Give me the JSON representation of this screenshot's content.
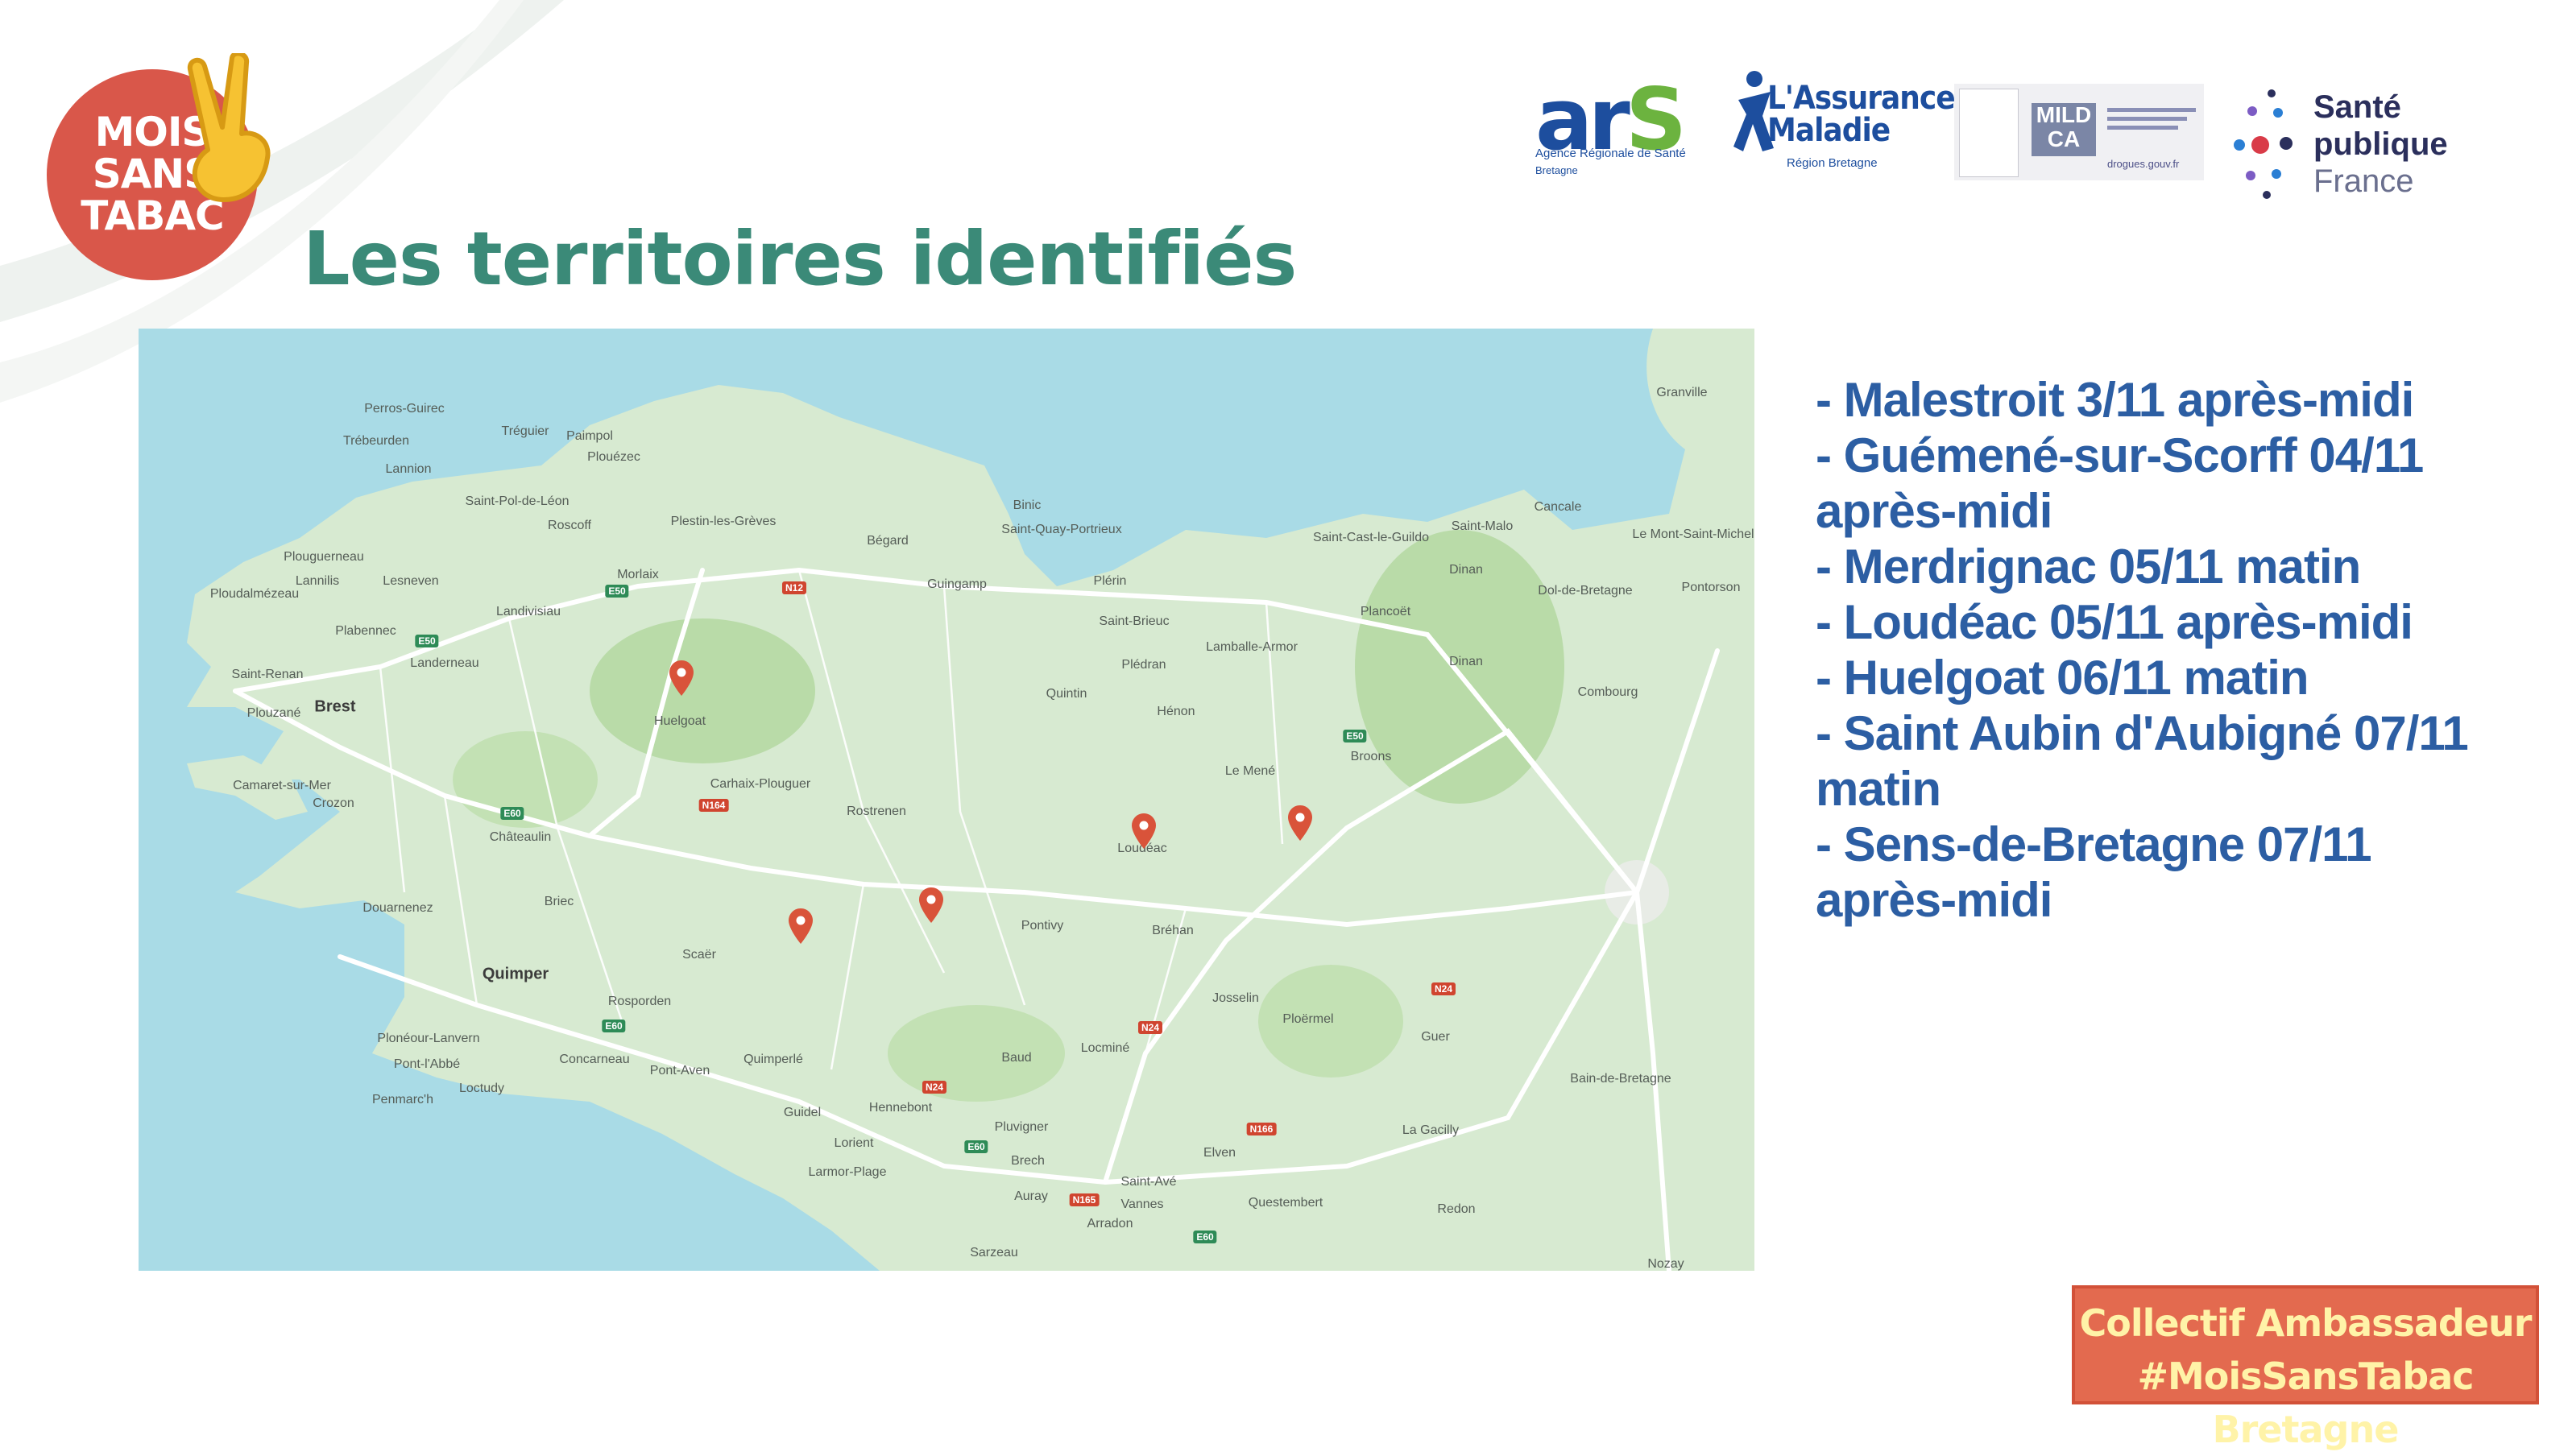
{
  "slide": {
    "title": "Les territoires identifiés"
  },
  "logo": {
    "line1": "MOIS",
    "line2": "SANS",
    "line3": "TABAC"
  },
  "partners": {
    "ars": {
      "main": "ar",
      "accent": "S",
      "subtitle": "Agence Régionale de Santé",
      "region": "Bretagne"
    },
    "assurance_maladie": {
      "line1": "L'Assurance",
      "line2": "Maladie",
      "region": "Région Bretagne"
    },
    "mildeca": {
      "acronym": "MILD CA",
      "url": "drogues.gouv.fr"
    },
    "spf": {
      "line1": "Santé",
      "line2": "publique",
      "line3": "France"
    }
  },
  "map": {
    "places": [
      {
        "name": "Perros-Guirec"
      },
      {
        "name": "Trébeurden"
      },
      {
        "name": "Tréguier"
      },
      {
        "name": "Paimpol"
      },
      {
        "name": "Plouézec"
      },
      {
        "name": "Lannion"
      },
      {
        "name": "Roscoff"
      },
      {
        "name": "Saint-Pol-de-Léon"
      },
      {
        "name": "Plestin-les-Grèves"
      },
      {
        "name": "Binic"
      },
      {
        "name": "Saint-Quay-Portrieux"
      },
      {
        "name": "Bégard"
      },
      {
        "name": "Saint-Cast-le-Guildo"
      },
      {
        "name": "Saint-Malo"
      },
      {
        "name": "Cancale"
      },
      {
        "name": "Granville"
      },
      {
        "name": "Le Mont-Saint-Michel"
      },
      {
        "name": "Plouguerneau"
      },
      {
        "name": "Lannilis"
      },
      {
        "name": "Lesneven"
      },
      {
        "name": "Morlaix"
      },
      {
        "name": "Guingamp"
      },
      {
        "name": "Plérin"
      },
      {
        "name": "Plancoët"
      },
      {
        "name": "Dinan"
      },
      {
        "name": "Dol-de-Bretagne"
      },
      {
        "name": "Pontorson"
      },
      {
        "name": "Ploudalmézeau"
      },
      {
        "name": "Landivisiau"
      },
      {
        "name": "Plabennec"
      },
      {
        "name": "Saint-Brieuc"
      },
      {
        "name": "Lamballe-Armor"
      },
      {
        "name": "Landerneau"
      },
      {
        "name": "Saint-Renan"
      },
      {
        "name": "Plédran"
      },
      {
        "name": "Dinan"
      },
      {
        "name": "Brest"
      },
      {
        "name": "Plouzané"
      },
      {
        "name": "Quintin"
      },
      {
        "name": "Hénon"
      },
      {
        "name": "Combourg"
      },
      {
        "name": "Huelgoat"
      },
      {
        "name": "Le Mené"
      },
      {
        "name": "Broons"
      },
      {
        "name": "Camaret-sur-Mer"
      },
      {
        "name": "Crozon"
      },
      {
        "name": "Carhaix-Plouguer"
      },
      {
        "name": "Rostrenen"
      },
      {
        "name": "Loudéac"
      },
      {
        "name": "Châteaulin"
      },
      {
        "name": "Douarnenez"
      },
      {
        "name": "Briec"
      },
      {
        "name": "Pontivy"
      },
      {
        "name": "Bréhan"
      },
      {
        "name": "Scaër"
      },
      {
        "name": "Quimper"
      },
      {
        "name": "Josselin"
      },
      {
        "name": "Ploërmel"
      },
      {
        "name": "Rosporden"
      },
      {
        "name": "Locminé"
      },
      {
        "name": "Guer"
      },
      {
        "name": "Plonéour-Lanvern"
      },
      {
        "name": "Baud"
      },
      {
        "name": "Pont-l'Abbé"
      },
      {
        "name": "Concarneau"
      },
      {
        "name": "Pont-Aven"
      },
      {
        "name": "Quimperlé"
      },
      {
        "name": "Bain-de-Bretagne"
      },
      {
        "name": "Loctudy"
      },
      {
        "name": "Penmarc'h"
      },
      {
        "name": "Hennebont"
      },
      {
        "name": "Guidel"
      },
      {
        "name": "Pluvigner"
      },
      {
        "name": "Lorient"
      },
      {
        "name": "La Gacilly"
      },
      {
        "name": "Larmor-Plage"
      },
      {
        "name": "Brech"
      },
      {
        "name": "Elven"
      },
      {
        "name": "Auray"
      },
      {
        "name": "Saint-Avé"
      },
      {
        "name": "Vannes"
      },
      {
        "name": "Questembert"
      },
      {
        "name": "Redon"
      },
      {
        "name": "Arradon"
      },
      {
        "name": "Sarzeau"
      },
      {
        "name": "Nozay"
      }
    ],
    "roads": [
      {
        "label": "N12",
        "color": "red"
      },
      {
        "label": "E50",
        "color": "green"
      },
      {
        "label": "E50",
        "color": "green"
      },
      {
        "label": "E50",
        "color": "green"
      },
      {
        "label": "N164",
        "color": "red"
      },
      {
        "label": "E60",
        "color": "green"
      },
      {
        "label": "E60",
        "color": "green"
      },
      {
        "label": "N24",
        "color": "red"
      },
      {
        "label": "N24",
        "color": "red"
      },
      {
        "label": "N24",
        "color": "red"
      },
      {
        "label": "E60",
        "color": "green"
      },
      {
        "label": "N165",
        "color": "red"
      },
      {
        "label": "N166",
        "color": "red"
      },
      {
        "label": "E60",
        "color": "green"
      }
    ],
    "markers": [
      {
        "name": "Huelgoat"
      },
      {
        "name": "Guémené-sur-Scorff"
      },
      {
        "name": "Rostrenen area"
      },
      {
        "name": "Loudéac"
      },
      {
        "name": "Merdrignac"
      }
    ],
    "colors": {
      "sea": "#a9dbe6",
      "land": "#d7ead1",
      "forest": "#b9dba8",
      "road": "#ffffff",
      "marker": "#d9533a"
    }
  },
  "sessions": [
    "- Malestroit 3/11 après-midi",
    "- Guémené-sur-Scorff 04/11 après-midi",
    "- Merdrignac 05/11 matin",
    "- Loudéac 05/11 après-midi",
    "- Huelgoat 06/11 matin",
    "- Saint Aubin d'Aubigné 07/11 matin",
    "- Sens-de-Bretagne 07/11 après-midi"
  ],
  "badge": {
    "line1": "Collectif Ambassadeur",
    "line2": "#MoisSansTabac Bretagne"
  },
  "colors": {
    "title": "#3b8a78",
    "sessions": "#2c5ea3",
    "badge_bg": "#e36a4f",
    "badge_text": "#fff3a8",
    "logo_red": "#d9574a"
  }
}
